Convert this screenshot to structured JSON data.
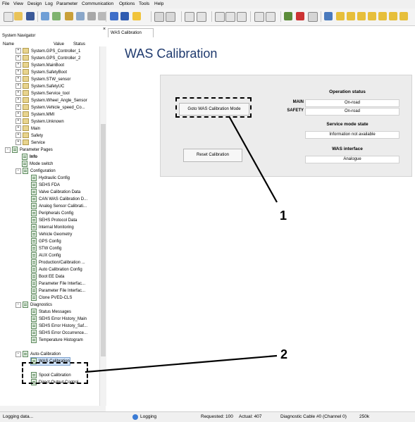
{
  "menu": [
    "File",
    "View",
    "Design",
    "Log",
    "Parameter",
    "Communication",
    "Options",
    "Tools",
    "Help"
  ],
  "navigator": {
    "title": "System Navigator",
    "close": "×",
    "col_name": "Name",
    "col_value": "Value",
    "col_status": "Status"
  },
  "tree": [
    {
      "label": "System.GPS_Controller_1",
      "level": 2,
      "type": "folder",
      "exp": "+"
    },
    {
      "label": "System.GPS_Controller_2",
      "level": 2,
      "type": "folder",
      "exp": "+"
    },
    {
      "label": "System.MainBoot",
      "level": 2,
      "type": "folder",
      "exp": "+"
    },
    {
      "label": "System.SafetyBoot",
      "level": 2,
      "type": "folder",
      "exp": "+"
    },
    {
      "label": "System.STW_sensor",
      "level": 2,
      "type": "folder",
      "exp": "+"
    },
    {
      "label": "System.SafetyUC",
      "level": 2,
      "type": "folder",
      "exp": "+"
    },
    {
      "label": "System.Service_tool",
      "level": 2,
      "type": "folder",
      "exp": "+"
    },
    {
      "label": "System.Wheel_Angle_Sensor",
      "level": 2,
      "type": "folder",
      "exp": "+"
    },
    {
      "label": "System.Vehicle_speed_Co...",
      "level": 2,
      "type": "folder",
      "exp": "+"
    },
    {
      "label": "System.MMI",
      "level": 2,
      "type": "folder",
      "exp": "+"
    },
    {
      "label": "System.Unknown",
      "level": 2,
      "type": "folder",
      "exp": "+"
    },
    {
      "label": "Main",
      "level": 2,
      "type": "folder",
      "exp": "+"
    },
    {
      "label": "Safety",
      "level": 2,
      "type": "folder",
      "exp": "+"
    },
    {
      "label": "Service",
      "level": 2,
      "type": "folder",
      "exp": "+"
    },
    {
      "label": "Parameter Pages",
      "level": 1,
      "type": "page",
      "exp": "−"
    },
    {
      "label": "Info",
      "level": 2,
      "type": "page",
      "bold": true
    },
    {
      "label": "Mode switch",
      "level": 2,
      "type": "page"
    },
    {
      "label": "Configuration",
      "level": 2,
      "type": "page",
      "exp": "−"
    },
    {
      "label": "Hydraulic Config",
      "level": 3,
      "type": "page"
    },
    {
      "label": "SEHS FDA",
      "level": 3,
      "type": "page"
    },
    {
      "label": "Valve Calibration Data",
      "level": 3,
      "type": "page"
    },
    {
      "label": "CAN WAS Calibration D...",
      "level": 3,
      "type": "page"
    },
    {
      "label": "Analog Sensor Calibrati...",
      "level": 3,
      "type": "page"
    },
    {
      "label": "Peripherals Config",
      "level": 3,
      "type": "page"
    },
    {
      "label": "SEHS Protocol Data",
      "level": 3,
      "type": "page"
    },
    {
      "label": "Internal Monitoring",
      "level": 3,
      "type": "page"
    },
    {
      "label": "Vehicle Geometry",
      "level": 3,
      "type": "page"
    },
    {
      "label": "GPS Config",
      "level": 3,
      "type": "page"
    },
    {
      "label": "STW Config",
      "level": 3,
      "type": "page"
    },
    {
      "label": "AUX Config",
      "level": 3,
      "type": "page"
    },
    {
      "label": "Production/Calibration ...",
      "level": 3,
      "type": "page"
    },
    {
      "label": "Auto Calibration Config",
      "level": 3,
      "type": "page"
    },
    {
      "label": "Boot EE Data",
      "level": 3,
      "type": "page"
    },
    {
      "label": "Parameter File Interfac...",
      "level": 3,
      "type": "page"
    },
    {
      "label": "Parameter File Interfac...",
      "level": 3,
      "type": "page"
    },
    {
      "label": "Clone PVED-CLS",
      "level": 3,
      "type": "page"
    },
    {
      "label": "Diagnostics",
      "level": 2,
      "type": "page",
      "exp": "−"
    },
    {
      "label": "Status Messages",
      "level": 3,
      "type": "page"
    },
    {
      "label": "SEHS Error History_Main",
      "level": 3,
      "type": "page"
    },
    {
      "label": "SEHS Error History_Saf...",
      "level": 3,
      "type": "page"
    },
    {
      "label": "SEHS Error Occurrence...",
      "level": 3,
      "type": "page"
    },
    {
      "label": "Temperature Histogram",
      "level": 3,
      "type": "page"
    },
    {
      "label": "",
      "level": 3,
      "type": "none"
    },
    {
      "label": "Auto-Calibration",
      "level": 2,
      "type": "page",
      "exp": "−"
    },
    {
      "label": "WAS Calibration",
      "level": 3,
      "type": "page",
      "selected": true
    },
    {
      "label": "",
      "level": 3,
      "type": "none"
    },
    {
      "label": "Spool Calibration",
      "level": 3,
      "type": "page"
    },
    {
      "label": "Direct Output Control",
      "level": 3,
      "type": "page"
    }
  ],
  "tab": {
    "label": "WAS Calibration"
  },
  "page": {
    "title": "WAS Calibration",
    "goto_button": "Goto WAS Calibration Mode",
    "reset_button": "Reset Calibration",
    "operation_status": {
      "heading": "Operation status",
      "main_label": "MAIN",
      "main_value": "On-road",
      "safety_label": "SAFETY",
      "safety_value": "On-road"
    },
    "service_mode": {
      "heading": "Service mode state",
      "value": "Information not available"
    },
    "was_interface": {
      "heading": "WAS interface",
      "value": "Analogue"
    }
  },
  "callouts": {
    "one": "1",
    "two": "2"
  },
  "status": {
    "left": "Logging data...",
    "logging": "Logging",
    "requested": "Requested: 100",
    "actual": "Actual: 407",
    "cable": "Diagnostic Cable #0 (Channel 0)",
    "baud": "250k"
  },
  "colors": {
    "title": "#1f3a6e",
    "panel": "#ececec",
    "selected": "#cfe2f8"
  }
}
